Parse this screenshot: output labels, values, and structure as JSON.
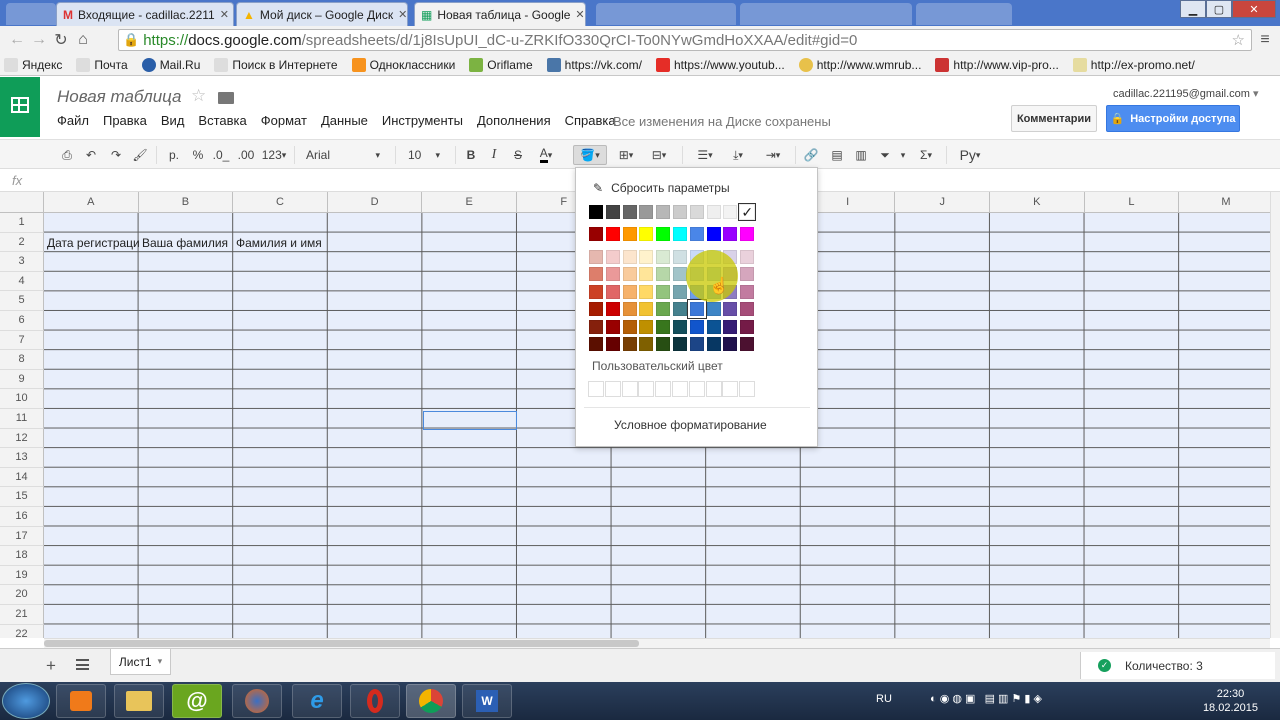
{
  "browser": {
    "tabs": [
      {
        "title": "Входящие - cadillac.2211",
        "icon": "gmail-icon",
        "active": false
      },
      {
        "title": "Мой диск – Google Диск",
        "icon": "drive-icon",
        "active": false
      },
      {
        "title": "Новая таблица - Google",
        "icon": "sheets-icon",
        "active": true
      }
    ],
    "url_prefix": "https://",
    "url_host": "docs.google.com",
    "url_path": "/spreadsheets/d/1j8IsUpUI_dC-u-ZRKIfO330QrCI-To0NYwGmdHoXXAA/edit#gid=0",
    "bookmarks": [
      "Яндекс",
      "Почта",
      "Mail.Ru",
      "Поиск в Интернете",
      "Одноклассники",
      "Oriflame",
      "https://vk.com/",
      "https://www.youtub...",
      "http://www.wmrub...",
      "http://www.vip-pro...",
      "http://ex-promo.net/"
    ]
  },
  "doc": {
    "title": "Новая таблица",
    "menus": [
      "Файл",
      "Правка",
      "Вид",
      "Вставка",
      "Формат",
      "Данные",
      "Инструменты",
      "Дополнения",
      "Справка"
    ],
    "saved_status": "Все изменения на Диске сохранены",
    "account_email": "cadillac.221195@gmail.com",
    "comments_label": "Комментарии",
    "share_label": "Настройки доступа"
  },
  "toolbar": {
    "currency": "р.",
    "percent": "%",
    "dec_less": ".0_",
    "dec_more": ".00",
    "format_123": "123",
    "font": "Arial",
    "font_size": "10",
    "bold": "B",
    "italic": "I",
    "strike": "S",
    "text_color": "A",
    "sigma": "Σ",
    "input_lang": "Ру"
  },
  "formula_bar": {
    "fx": "fx"
  },
  "sheet": {
    "columns": [
      "A",
      "B",
      "C",
      "D",
      "E",
      "F",
      "G",
      "H",
      "I",
      "J",
      "K",
      "L",
      "M"
    ],
    "rows": [
      "1",
      "2",
      "3",
      "4",
      "5",
      "6",
      "7",
      "8",
      "9",
      "10",
      "11",
      "12",
      "13",
      "14",
      "15",
      "16",
      "17",
      "18",
      "19",
      "20",
      "21",
      "22"
    ],
    "row2_cells": [
      "Дата регистрации",
      "Ваша фамилия",
      "Фамилия и имя"
    ]
  },
  "palette": {
    "reset_label": "Сбросить параметры",
    "custom_label": "Пользовательский цвет",
    "conditional_label": "Условное форматирование",
    "gray_row": [
      "#000000",
      "#434343",
      "#666666",
      "#999999",
      "#b7b7b7",
      "#cccccc",
      "#d9d9d9",
      "#efefef",
      "#f3f3f3",
      "#ffffff"
    ],
    "bright_row": [
      "#980000",
      "#ff0000",
      "#ff9900",
      "#ffff00",
      "#00ff00",
      "#00ffff",
      "#4a86e8",
      "#0000ff",
      "#9900ff",
      "#ff00ff"
    ],
    "shade_rows": [
      [
        "#e6b8af",
        "#f4cccc",
        "#fce5cd",
        "#fff2cc",
        "#d9ead3",
        "#d0e0e3",
        "#c9daf8",
        "#cfe2f3",
        "#d9d2e9",
        "#ead1dc"
      ],
      [
        "#dd7e6b",
        "#ea9999",
        "#f9cb9c",
        "#ffe599",
        "#b6d7a8",
        "#a2c4c9",
        "#a4c2f4",
        "#9fc5e8",
        "#b4a7d6",
        "#d5a6bd"
      ],
      [
        "#cc4125",
        "#e06666",
        "#f6b26b",
        "#ffd966",
        "#93c47d",
        "#76a5af",
        "#6d9eeb",
        "#6fa8dc",
        "#8e7cc3",
        "#c27ba0"
      ],
      [
        "#a61c00",
        "#cc0000",
        "#e69138",
        "#f1c232",
        "#6aa84f",
        "#45818e",
        "#3c78d8",
        "#3d85c6",
        "#674ea7",
        "#a64d79"
      ],
      [
        "#85200c",
        "#990000",
        "#b45f06",
        "#bf9000",
        "#38761d",
        "#134f5c",
        "#1155cc",
        "#0b5394",
        "#351c75",
        "#741b47"
      ],
      [
        "#5b0f00",
        "#660000",
        "#783f04",
        "#7f6000",
        "#274e13",
        "#0c343d",
        "#1c4587",
        "#073763",
        "#20124d",
        "#4c1130"
      ]
    ],
    "selected_check": "✓"
  },
  "sheetbar": {
    "add": "+",
    "tab_name": "Лист1",
    "count_label": "Количество: 3"
  },
  "taskbar": {
    "lang": "RU",
    "time": "22:30",
    "date": "18.02.2015"
  }
}
